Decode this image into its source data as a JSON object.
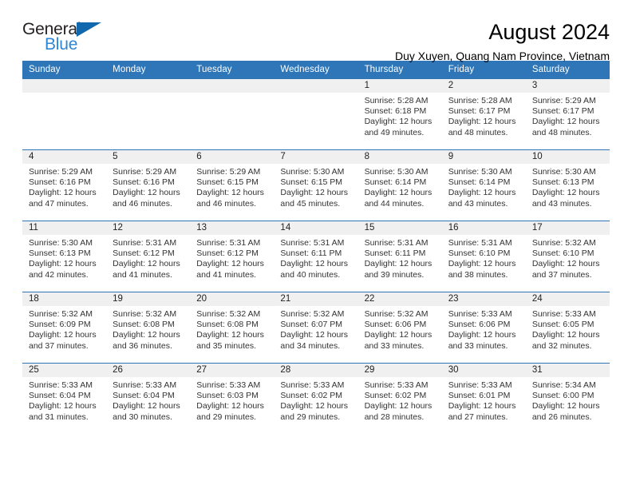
{
  "logo": {
    "word_one": "General",
    "word_two": "Blue",
    "triangle_color": "#1268ad",
    "blue_color": "#2e86d4"
  },
  "header": {
    "title": "August 2024",
    "subtitle": "Duy Xuyen, Quang Nam Province, Vietnam",
    "accent_color": "#2e76b8",
    "daynum_bg": "#f0f0f0"
  },
  "calendar": {
    "weekday_headers": [
      "Sunday",
      "Monday",
      "Tuesday",
      "Wednesday",
      "Thursday",
      "Friday",
      "Saturday"
    ],
    "weeks": [
      [
        {
          "day": "",
          "sunrise": "",
          "sunset": "",
          "daylight_1": "",
          "daylight_2": ""
        },
        {
          "day": "",
          "sunrise": "",
          "sunset": "",
          "daylight_1": "",
          "daylight_2": ""
        },
        {
          "day": "",
          "sunrise": "",
          "sunset": "",
          "daylight_1": "",
          "daylight_2": ""
        },
        {
          "day": "",
          "sunrise": "",
          "sunset": "",
          "daylight_1": "",
          "daylight_2": ""
        },
        {
          "day": "1",
          "sunrise": "Sunrise: 5:28 AM",
          "sunset": "Sunset: 6:18 PM",
          "daylight_1": "Daylight: 12 hours",
          "daylight_2": "and 49 minutes."
        },
        {
          "day": "2",
          "sunrise": "Sunrise: 5:28 AM",
          "sunset": "Sunset: 6:17 PM",
          "daylight_1": "Daylight: 12 hours",
          "daylight_2": "and 48 minutes."
        },
        {
          "day": "3",
          "sunrise": "Sunrise: 5:29 AM",
          "sunset": "Sunset: 6:17 PM",
          "daylight_1": "Daylight: 12 hours",
          "daylight_2": "and 48 minutes."
        }
      ],
      [
        {
          "day": "4",
          "sunrise": "Sunrise: 5:29 AM",
          "sunset": "Sunset: 6:16 PM",
          "daylight_1": "Daylight: 12 hours",
          "daylight_2": "and 47 minutes."
        },
        {
          "day": "5",
          "sunrise": "Sunrise: 5:29 AM",
          "sunset": "Sunset: 6:16 PM",
          "daylight_1": "Daylight: 12 hours",
          "daylight_2": "and 46 minutes."
        },
        {
          "day": "6",
          "sunrise": "Sunrise: 5:29 AM",
          "sunset": "Sunset: 6:15 PM",
          "daylight_1": "Daylight: 12 hours",
          "daylight_2": "and 46 minutes."
        },
        {
          "day": "7",
          "sunrise": "Sunrise: 5:30 AM",
          "sunset": "Sunset: 6:15 PM",
          "daylight_1": "Daylight: 12 hours",
          "daylight_2": "and 45 minutes."
        },
        {
          "day": "8",
          "sunrise": "Sunrise: 5:30 AM",
          "sunset": "Sunset: 6:14 PM",
          "daylight_1": "Daylight: 12 hours",
          "daylight_2": "and 44 minutes."
        },
        {
          "day": "9",
          "sunrise": "Sunrise: 5:30 AM",
          "sunset": "Sunset: 6:14 PM",
          "daylight_1": "Daylight: 12 hours",
          "daylight_2": "and 43 minutes."
        },
        {
          "day": "10",
          "sunrise": "Sunrise: 5:30 AM",
          "sunset": "Sunset: 6:13 PM",
          "daylight_1": "Daylight: 12 hours",
          "daylight_2": "and 43 minutes."
        }
      ],
      [
        {
          "day": "11",
          "sunrise": "Sunrise: 5:30 AM",
          "sunset": "Sunset: 6:13 PM",
          "daylight_1": "Daylight: 12 hours",
          "daylight_2": "and 42 minutes."
        },
        {
          "day": "12",
          "sunrise": "Sunrise: 5:31 AM",
          "sunset": "Sunset: 6:12 PM",
          "daylight_1": "Daylight: 12 hours",
          "daylight_2": "and 41 minutes."
        },
        {
          "day": "13",
          "sunrise": "Sunrise: 5:31 AM",
          "sunset": "Sunset: 6:12 PM",
          "daylight_1": "Daylight: 12 hours",
          "daylight_2": "and 41 minutes."
        },
        {
          "day": "14",
          "sunrise": "Sunrise: 5:31 AM",
          "sunset": "Sunset: 6:11 PM",
          "daylight_1": "Daylight: 12 hours",
          "daylight_2": "and 40 minutes."
        },
        {
          "day": "15",
          "sunrise": "Sunrise: 5:31 AM",
          "sunset": "Sunset: 6:11 PM",
          "daylight_1": "Daylight: 12 hours",
          "daylight_2": "and 39 minutes."
        },
        {
          "day": "16",
          "sunrise": "Sunrise: 5:31 AM",
          "sunset": "Sunset: 6:10 PM",
          "daylight_1": "Daylight: 12 hours",
          "daylight_2": "and 38 minutes."
        },
        {
          "day": "17",
          "sunrise": "Sunrise: 5:32 AM",
          "sunset": "Sunset: 6:10 PM",
          "daylight_1": "Daylight: 12 hours",
          "daylight_2": "and 37 minutes."
        }
      ],
      [
        {
          "day": "18",
          "sunrise": "Sunrise: 5:32 AM",
          "sunset": "Sunset: 6:09 PM",
          "daylight_1": "Daylight: 12 hours",
          "daylight_2": "and 37 minutes."
        },
        {
          "day": "19",
          "sunrise": "Sunrise: 5:32 AM",
          "sunset": "Sunset: 6:08 PM",
          "daylight_1": "Daylight: 12 hours",
          "daylight_2": "and 36 minutes."
        },
        {
          "day": "20",
          "sunrise": "Sunrise: 5:32 AM",
          "sunset": "Sunset: 6:08 PM",
          "daylight_1": "Daylight: 12 hours",
          "daylight_2": "and 35 minutes."
        },
        {
          "day": "21",
          "sunrise": "Sunrise: 5:32 AM",
          "sunset": "Sunset: 6:07 PM",
          "daylight_1": "Daylight: 12 hours",
          "daylight_2": "and 34 minutes."
        },
        {
          "day": "22",
          "sunrise": "Sunrise: 5:32 AM",
          "sunset": "Sunset: 6:06 PM",
          "daylight_1": "Daylight: 12 hours",
          "daylight_2": "and 33 minutes."
        },
        {
          "day": "23",
          "sunrise": "Sunrise: 5:33 AM",
          "sunset": "Sunset: 6:06 PM",
          "daylight_1": "Daylight: 12 hours",
          "daylight_2": "and 33 minutes."
        },
        {
          "day": "24",
          "sunrise": "Sunrise: 5:33 AM",
          "sunset": "Sunset: 6:05 PM",
          "daylight_1": "Daylight: 12 hours",
          "daylight_2": "and 32 minutes."
        }
      ],
      [
        {
          "day": "25",
          "sunrise": "Sunrise: 5:33 AM",
          "sunset": "Sunset: 6:04 PM",
          "daylight_1": "Daylight: 12 hours",
          "daylight_2": "and 31 minutes."
        },
        {
          "day": "26",
          "sunrise": "Sunrise: 5:33 AM",
          "sunset": "Sunset: 6:04 PM",
          "daylight_1": "Daylight: 12 hours",
          "daylight_2": "and 30 minutes."
        },
        {
          "day": "27",
          "sunrise": "Sunrise: 5:33 AM",
          "sunset": "Sunset: 6:03 PM",
          "daylight_1": "Daylight: 12 hours",
          "daylight_2": "and 29 minutes."
        },
        {
          "day": "28",
          "sunrise": "Sunrise: 5:33 AM",
          "sunset": "Sunset: 6:02 PM",
          "daylight_1": "Daylight: 12 hours",
          "daylight_2": "and 29 minutes."
        },
        {
          "day": "29",
          "sunrise": "Sunrise: 5:33 AM",
          "sunset": "Sunset: 6:02 PM",
          "daylight_1": "Daylight: 12 hours",
          "daylight_2": "and 28 minutes."
        },
        {
          "day": "30",
          "sunrise": "Sunrise: 5:33 AM",
          "sunset": "Sunset: 6:01 PM",
          "daylight_1": "Daylight: 12 hours",
          "daylight_2": "and 27 minutes."
        },
        {
          "day": "31",
          "sunrise": "Sunrise: 5:34 AM",
          "sunset": "Sunset: 6:00 PM",
          "daylight_1": "Daylight: 12 hours",
          "daylight_2": "and 26 minutes."
        }
      ]
    ]
  }
}
